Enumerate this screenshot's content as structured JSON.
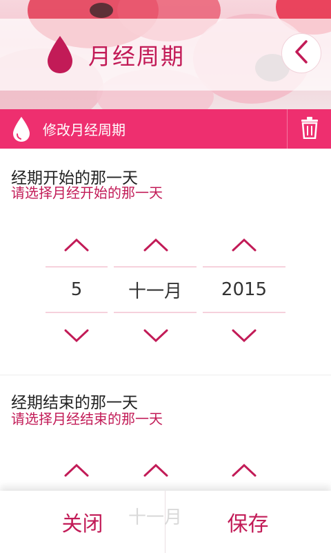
{
  "header": {
    "title": "月经周期",
    "icons": {
      "logo": "blood-drop-icon",
      "back": "chevron-left-icon"
    },
    "colors": {
      "accent": "#c21b57",
      "brand": "#ee2f6f"
    }
  },
  "section": {
    "title": "修改月经周期",
    "icons": {
      "drop": "blood-drop-icon",
      "delete": "trash-icon"
    }
  },
  "start": {
    "title": "经期开始的那一天",
    "hint": "请选择月经开始的那一天",
    "day": "5",
    "month": "十一月",
    "year": "2015"
  },
  "end": {
    "title": "经期结束的那一天",
    "hint": "请选择月经结束的那一天",
    "month_partial": "十一月"
  },
  "footer": {
    "close_label": "关闭",
    "save_label": "保存"
  }
}
